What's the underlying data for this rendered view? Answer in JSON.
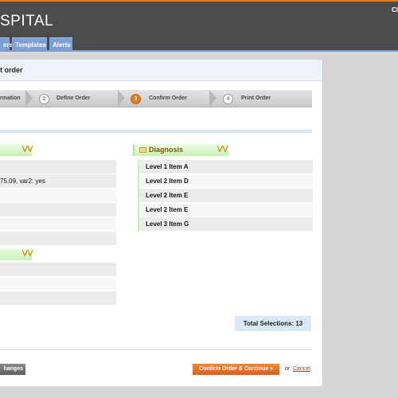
{
  "header": {
    "logo_text": "SPITAL",
    "user_link": "Cl"
  },
  "nav": {
    "tabs": [
      "ers",
      "Templates",
      "Alerts"
    ]
  },
  "panel": {
    "title": "t order"
  },
  "steps": [
    {
      "num": "",
      "label": "rmation"
    },
    {
      "num": "2",
      "label": "Define Order"
    },
    {
      "num": "3",
      "label": "Confirm Order"
    },
    {
      "num": "4",
      "label": "Print Order"
    }
  ],
  "left_section_1": {
    "rows": [
      "",
      "75.09, var2: yes",
      "",
      "",
      "",
      ""
    ]
  },
  "left_section_2": {
    "rows": [
      "",
      "",
      ""
    ]
  },
  "diagnosis": {
    "title": "Diagnosis",
    "rows": [
      "Level 1 Item A",
      "Level 2 Item D",
      "Level 2 Item E",
      "Level 2 Item E",
      "Level 3 Item G"
    ]
  },
  "total_selections": "Total Selections: 13",
  "buttons": {
    "changes": "hanges",
    "confirm": "Confirm Order & Continue »",
    "or": "or",
    "cancel": "Cancel"
  },
  "colors": {
    "accent_orange": "#e07b26",
    "nav_blue": "#7c9fd4",
    "header_dark": "#4c4c4c",
    "section_green": "#c9f2b5"
  }
}
